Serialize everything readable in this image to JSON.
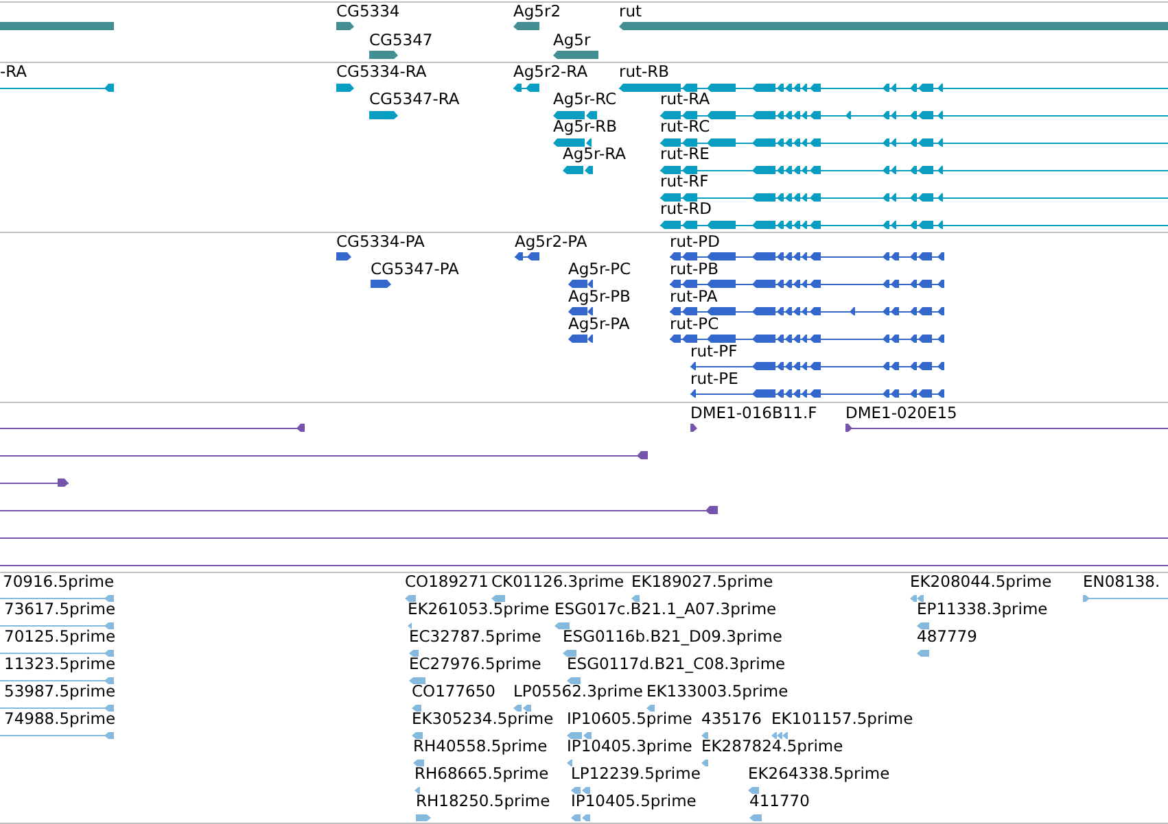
{
  "tracks": [
    {
      "kind": "gene",
      "features": [
        {
          "label": "CG5334"
        },
        {
          "label": "Ag5r2"
        },
        {
          "label": "rut"
        },
        {
          "label": "CG5347"
        },
        {
          "label": "Ag5r"
        }
      ]
    },
    {
      "kind": "transcript",
      "features": [
        {
          "label": "-RA"
        },
        {
          "label": "CG5334-RA"
        },
        {
          "label": "Ag5r2-RA"
        },
        {
          "label": "rut-RB"
        },
        {
          "label": "CG5347-RA"
        },
        {
          "label": "Ag5r-RC"
        },
        {
          "label": "rut-RA"
        },
        {
          "label": "Ag5r-RB"
        },
        {
          "label": "rut-RC"
        },
        {
          "label": "Ag5r-RA"
        },
        {
          "label": "rut-RE"
        },
        {
          "label": "rut-RF"
        },
        {
          "label": "rut-RD"
        }
      ]
    },
    {
      "kind": "protein",
      "features": [
        {
          "label": "CG5334-PA"
        },
        {
          "label": "Ag5r2-PA"
        },
        {
          "label": "rut-PD"
        },
        {
          "label": "CG5347-PA"
        },
        {
          "label": "Ag5r-PC"
        },
        {
          "label": "rut-PB"
        },
        {
          "label": "Ag5r-PB"
        },
        {
          "label": "rut-PA"
        },
        {
          "label": "Ag5r-PA"
        },
        {
          "label": "rut-PC"
        },
        {
          "label": "rut-PF"
        },
        {
          "label": "rut-PE"
        }
      ]
    },
    {
      "kind": "clone",
      "features": [
        {
          "label": "DME1-016B11.F"
        },
        {
          "label": "DME1-020E15"
        }
      ]
    },
    {
      "kind": "est",
      "features": [
        {
          "label": "70916.5prime"
        },
        {
          "label": "CO189271"
        },
        {
          "label": "CK01126.3prime"
        },
        {
          "label": "EK189027.5prime"
        },
        {
          "label": "EK208044.5prime"
        },
        {
          "label": "EN08138."
        },
        {
          "label": "73617.5prime"
        },
        {
          "label": "EK261053.5prime"
        },
        {
          "label": "ESG017c.B21.1_A07.3prime"
        },
        {
          "label": "EP11338.3prime"
        },
        {
          "label": "70125.5prime"
        },
        {
          "label": "EC32787.5prime"
        },
        {
          "label": "ESG0116b.B21_D09.3prime"
        },
        {
          "label": "487779"
        },
        {
          "label": "11323.5prime"
        },
        {
          "label": "EC27976.5prime"
        },
        {
          "label": "ESG0117d.B21_C08.3prime"
        },
        {
          "label": "53987.5prime"
        },
        {
          "label": "CO177650"
        },
        {
          "label": "LP05562.3prime"
        },
        {
          "label": "EK133003.5prime"
        },
        {
          "label": "74988.5prime"
        },
        {
          "label": "EK305234.5prime"
        },
        {
          "label": "IP10605.5prime"
        },
        {
          "label": "435176"
        },
        {
          "label": "EK101157.5prime"
        },
        {
          "label": "RH40558.5prime"
        },
        {
          "label": "IP10405.3prime"
        },
        {
          "label": "EK287824.5prime"
        },
        {
          "label": "RH68665.5prime"
        },
        {
          "label": "LP12239.5prime"
        },
        {
          "label": "EK264338.5prime"
        },
        {
          "label": "RH18250.5prime"
        },
        {
          "label": "IP10405.5prime"
        },
        {
          "label": "411770"
        }
      ]
    }
  ]
}
